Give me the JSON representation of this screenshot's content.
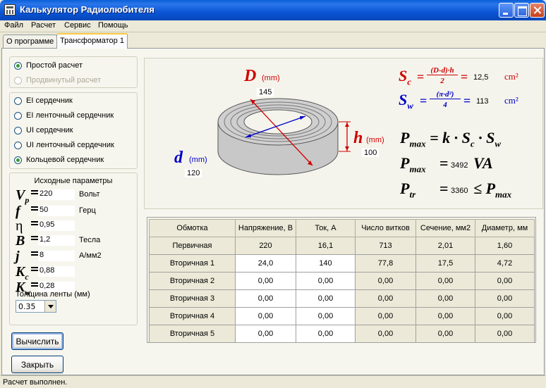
{
  "window": {
    "title": "Калькулятор Радиолюбителя"
  },
  "menu": [
    "Файл",
    "Расчет",
    "Сервис",
    "Помощь"
  ],
  "tabs": [
    {
      "label": "О программе",
      "active": false
    },
    {
      "label": "Трансформатор 1",
      "active": true
    }
  ],
  "mode": {
    "simple": "Простой расчет",
    "advanced": "Продвинутый расчет",
    "selected": "simple"
  },
  "core_types": {
    "items": [
      "EI сердечник",
      "EI ленточный сердечник",
      "UI сердечник",
      "UI ленточный сердечник",
      "Кольцевой сердечник"
    ],
    "selected_index": 4
  },
  "params": {
    "title": "Исходные параметры",
    "rows": [
      {
        "sym": "V",
        "sub": "p",
        "value": "220",
        "unit": "Вольт"
      },
      {
        "sym": "f",
        "sub": "",
        "value": "50",
        "unit": "Герц"
      },
      {
        "sym": "η",
        "sub": "",
        "value": "0,95",
        "unit": ""
      },
      {
        "sym": "B",
        "sub": "",
        "value": "1,2",
        "unit": "Тесла"
      },
      {
        "sym": "j",
        "sub": "",
        "value": "8",
        "unit": "А/мм2"
      },
      {
        "sym": "K",
        "sub": "c",
        "value": "0,88",
        "unit": ""
      },
      {
        "sym": "K",
        "sub": "w",
        "value": "0,28",
        "unit": ""
      }
    ],
    "tape_label": "Толщина ленты (мм)",
    "tape_value": "0.35"
  },
  "buttons": {
    "calculate": "Вычислить",
    "close": "Закрыть"
  },
  "diagram": {
    "D_label": "D",
    "D_unit": "(mm)",
    "D_value": "145",
    "d_label": "d",
    "d_unit": "(mm)",
    "d_value": "120",
    "h_label": "h",
    "h_unit": "(mm)",
    "h_value": "100"
  },
  "results": {
    "Sc_value": "12,5",
    "Sc_unit": "cm²",
    "Sw_value": "113",
    "Sw_unit": "cm²",
    "Pmax_value": "3492",
    "Pmax_unit": "VA",
    "Ptr_value": "3360"
  },
  "table": {
    "headers": [
      "Обмотка",
      "Напряжение, В",
      "Ток, А",
      "Число витков",
      "Сечение, мм2",
      "Диаметр, мм"
    ],
    "rows": [
      [
        "Первичная",
        "220",
        "16,1",
        "713",
        "2,01",
        "1,60"
      ],
      [
        "Вторичная 1",
        "24,0",
        "140",
        "77,8",
        "17,5",
        "4,72"
      ],
      [
        "Вторичная 2",
        "0,00",
        "0,00",
        "0,00",
        "0,00",
        "0,00"
      ],
      [
        "Вторичная 3",
        "0,00",
        "0,00",
        "0,00",
        "0,00",
        "0,00"
      ],
      [
        "Вторичная 4",
        "0,00",
        "0,00",
        "0,00",
        "0,00",
        "0,00"
      ],
      [
        "Вторичная 5",
        "0,00",
        "0,00",
        "0,00",
        "0,00",
        "0,00"
      ]
    ]
  },
  "status": "Расчет выполнен."
}
